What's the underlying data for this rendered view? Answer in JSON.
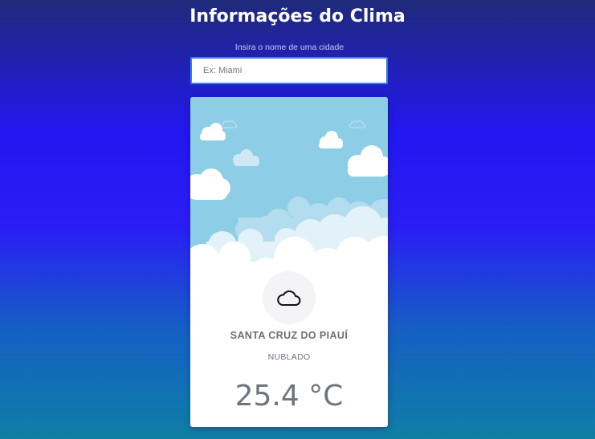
{
  "header": {
    "title": "Informações do Clima"
  },
  "search": {
    "label": "Insira o nome de uma cidade",
    "placeholder": "Ex: Miami",
    "value": ""
  },
  "weather": {
    "icon": "cloud-icon",
    "city": "SANTA CRUZ DO PIAUÍ",
    "condition": "NUBLADO",
    "temperature": "25.4 °C"
  },
  "colors": {
    "background_top": "#1f2a7a",
    "background_mid": "#2217f0",
    "background_bottom": "#0f7fa5",
    "sky": "#8ecde6",
    "input_border": "#3b7bf0"
  }
}
